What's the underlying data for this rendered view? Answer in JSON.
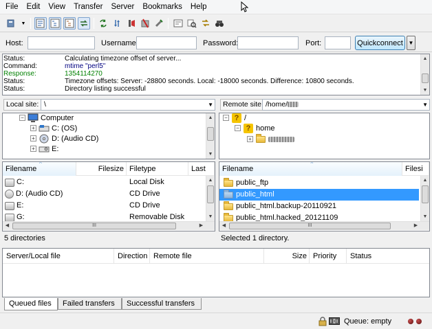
{
  "menubar": {
    "items": [
      "File",
      "Edit",
      "View",
      "Transfer",
      "Server",
      "Bookmarks",
      "Help"
    ]
  },
  "quickconnect": {
    "host_label": "Host:",
    "host_value": "",
    "username_label": "Username:",
    "username_value": "",
    "password_label": "Password:",
    "password_value": "",
    "port_label": "Port:",
    "port_value": "",
    "button_label": "Quickconnect"
  },
  "log": {
    "lines": [
      {
        "type": "Status:",
        "message": "Calculating timezone offset of server...",
        "kind": "status"
      },
      {
        "type": "Command:",
        "message": "mtime \"perl5\"",
        "kind": "command"
      },
      {
        "type": "Response:",
        "message": "1354114270",
        "kind": "response"
      },
      {
        "type": "Status:",
        "message": "Timezone offsets: Server: -28800 seconds. Local: -18000 seconds. Difference: 10800 seconds.",
        "kind": "status"
      },
      {
        "type": "Status:",
        "message": "Directory listing successful",
        "kind": "status"
      }
    ]
  },
  "local": {
    "site_label": "Local site:",
    "site_path": "\\",
    "tree": {
      "computer": "Computer",
      "drives": [
        "C: (OS)",
        "D: (Audio CD)",
        "E:"
      ]
    },
    "columns": [
      "Filename",
      "Filesize",
      "Filetype",
      "Last"
    ],
    "files": [
      {
        "name": "C:",
        "type": "Local Disk"
      },
      {
        "name": "D: (Audio CD)",
        "type": "CD Drive"
      },
      {
        "name": "E:",
        "type": "CD Drive"
      },
      {
        "name": "G:",
        "type": "Removable Disk"
      }
    ],
    "status": "5 directories"
  },
  "remote": {
    "site_label": "Remote site:",
    "site_path": "/home/",
    "tree": {
      "root": "/",
      "home": "home"
    },
    "columns": [
      "Filename",
      "Filesi"
    ],
    "files": [
      {
        "name": "public_ftp",
        "selected": false
      },
      {
        "name": "public_html",
        "selected": true
      },
      {
        "name": "public_html.backup-20110921",
        "selected": false
      },
      {
        "name": "public_html.hacked_20121109",
        "selected": false
      }
    ],
    "status": "Selected 1 directory."
  },
  "queue": {
    "columns": [
      "Server/Local file",
      "Direction",
      "Remote file",
      "Size",
      "Priority",
      "Status"
    ],
    "tabs": [
      "Queued files",
      "Failed transfers",
      "Successful transfers"
    ],
    "status": "Queue: empty"
  },
  "colors": {
    "selection": "#3399ff",
    "response_text": "#008000",
    "command_text": "#000080"
  }
}
